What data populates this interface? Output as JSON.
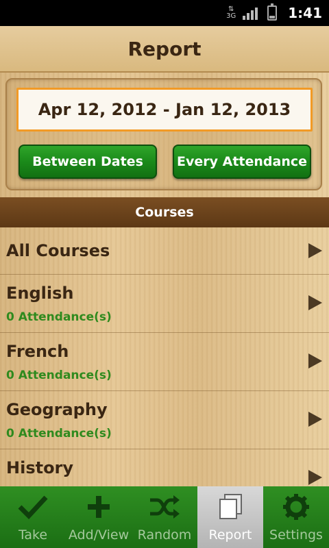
{
  "status_bar": {
    "network": "3G",
    "time": "1:41"
  },
  "title": "Report",
  "date_range": "Apr 12, 2012 - Jan 12, 2013",
  "buttons": {
    "between_dates": "Between Dates",
    "every_attendance": "Every Attendance"
  },
  "section_header": "Courses",
  "courses": [
    {
      "name": "All Courses",
      "count": ""
    },
    {
      "name": "English",
      "count": "0 Attendance(s)"
    },
    {
      "name": "French",
      "count": "0 Attendance(s)"
    },
    {
      "name": "Geography",
      "count": "0 Attendance(s)"
    },
    {
      "name": "History",
      "count": ""
    }
  ],
  "tabs": [
    {
      "label": "Take",
      "icon": "check-icon"
    },
    {
      "label": "Add/View",
      "icon": "plus-icon"
    },
    {
      "label": "Random",
      "icon": "shuffle-icon"
    },
    {
      "label": "Report",
      "icon": "report-icon",
      "active": true
    },
    {
      "label": "Settings",
      "icon": "gear-icon"
    }
  ],
  "colors": {
    "accent_green": "#1b8a1a",
    "count_green": "#2f8a1e",
    "date_border": "#f29a25"
  }
}
